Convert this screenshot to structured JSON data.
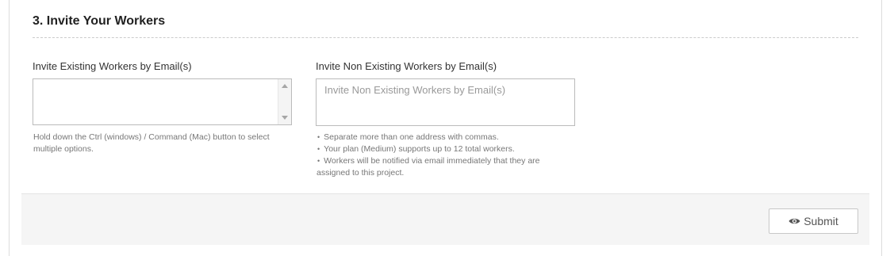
{
  "section": {
    "title": "3. Invite Your Workers"
  },
  "existing_workers": {
    "label": "Invite Existing Workers by Email(s)",
    "help": "Hold down the Ctrl (windows) / Command (Mac) button to select multiple options."
  },
  "non_existing_workers": {
    "label": "Invite Non Existing Workers by Email(s)",
    "placeholder": "Invite Non Existing Workers by Email(s)",
    "value": "",
    "help_items": [
      "Separate more than one address with commas.",
      "Your plan (Medium) supports up to 12 total workers.",
      "Workers will be notified via email immediately that they are assigned to this project."
    ]
  },
  "footer": {
    "submit_label": "Submit",
    "submit_icon": "eye-icon"
  }
}
